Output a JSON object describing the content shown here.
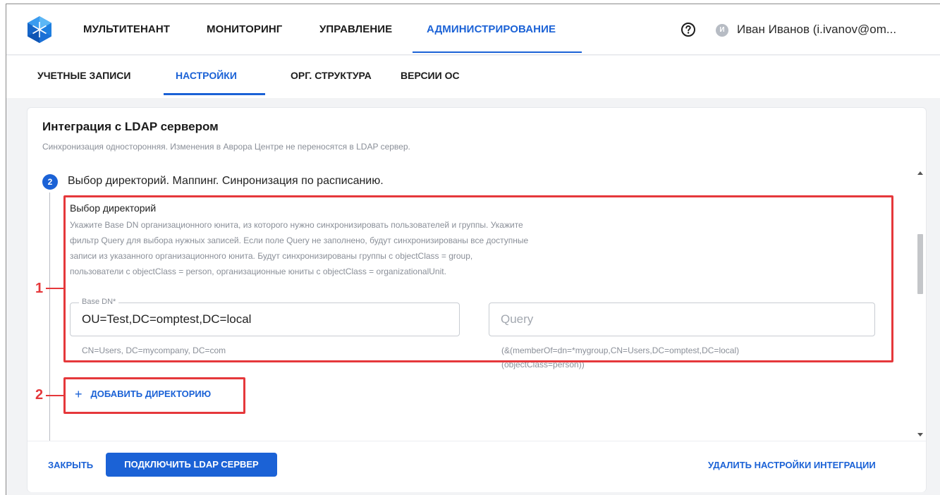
{
  "topnav": {
    "items": [
      "МУЛЬТИТЕНАНТ",
      "МОНИТОРИНГ",
      "УПРАВЛЕНИЕ",
      "АДМИНИСТРИРОВАНИЕ"
    ],
    "active": "АДМИНИСТРИРОВАНИЕ",
    "help_icon": "question-circle-icon",
    "user_avatar": "И",
    "user_name": "Иван Иванов (i.ivanov@om..."
  },
  "subnav": {
    "items": [
      "УЧЕТНЫЕ ЗАПИСИ",
      "НАСТРОЙКИ",
      "ОРГ. СТРУКТУРА",
      "ВЕРСИИ ОС"
    ],
    "active": "НАСТРОЙКИ"
  },
  "card": {
    "title": "Интеграция с LDAP сервером",
    "subtitle": "Синхронизация односторонняя. Изменения в Аврора Центре не переносятся в LDAP сервер.",
    "step": {
      "number": "2",
      "title": "Выбор директорий. Маппинг. Синронизация по расписанию."
    },
    "section": {
      "title": "Выбор директорий",
      "description_lines": [
        "Укажите Base DN организационного юнита, из которого нужно синхронизировать пользователей и группы. Укажите",
        "фильтр Query для выбора нужных записей. Если поле Query не заполнено, будут синхронизированы все доступные",
        "записи из указанного организационного юнита. Будут синхронизированы группы с objectClass = group,",
        "пользователи с objectClass = person, организационные юниты с objectClass = organizationalUnit."
      ]
    },
    "base_dn": {
      "label": "Base DN*",
      "value": "OU=Test,DC=omptest,DC=local",
      "hint": "CN=Users, DC=mycompany, DC=com"
    },
    "query": {
      "placeholder": "Query",
      "value": "",
      "hint_lines": [
        "(&(memberOf=dn=*mygroup,CN=Users,DC=omptest,DC=local)",
        "(objectClass=person))"
      ]
    },
    "add_directory": "ДОБАВИТЬ ДИРЕКТОРИЮ",
    "footer": {
      "close": "ЗАКРЫТЬ",
      "connect": "ПОДКЛЮЧИТЬ LDAP СЕРВЕР",
      "delete": "УДАЛИТЬ НАСТРОЙКИ ИНТЕГРАЦИИ"
    }
  },
  "annotations": {
    "callout_1": "1",
    "callout_2": "2",
    "color": "#e5383b"
  },
  "colors": {
    "accent": "#1b62d6",
    "muted_text": "#8a8f98",
    "background": "#f2f3f5"
  }
}
